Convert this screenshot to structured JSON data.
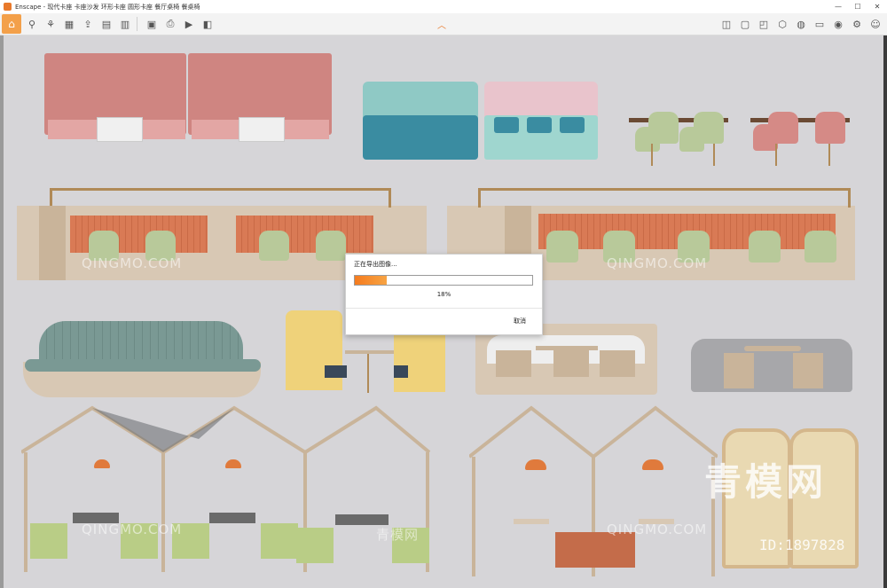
{
  "window": {
    "app_name": "Enscape",
    "title": "Enscape - 现代卡座 卡座沙发 环形卡座 圆形卡座 餐厅桌椅 餐桌椅",
    "controls": {
      "minimize": "—",
      "maximize": "☐",
      "close": "✕"
    }
  },
  "toolbar": {
    "home_icon": "home-icon",
    "center_chevron": "︿",
    "left_icons": [
      "rooms-icon",
      "assets-icon",
      "bim-icon",
      "upload-icon",
      "library-icon",
      "batch-icon",
      "image-icon",
      "export-icon",
      "video-icon",
      "panorama-icon"
    ],
    "right_icons": [
      "map-icon",
      "views-icon",
      "screenshot-icon",
      "cube-icon",
      "material-icon",
      "asset-editor-icon",
      "visibility-icon",
      "settings-icon",
      "feedback-icon"
    ]
  },
  "colors": {
    "accent": "#f3a04a",
    "progress_start": "#f57b1e",
    "progress_end": "#f7a444",
    "viewport_bg": "#d6d5d8"
  },
  "dialog": {
    "title": "正在导出图像...",
    "progress_percent": 18,
    "progress_text": "18%",
    "cancel_label": "取消"
  },
  "watermarks": {
    "site": "QINGMO.COM",
    "brand_cn": "青模网",
    "id_text": "ID:1897828"
  }
}
